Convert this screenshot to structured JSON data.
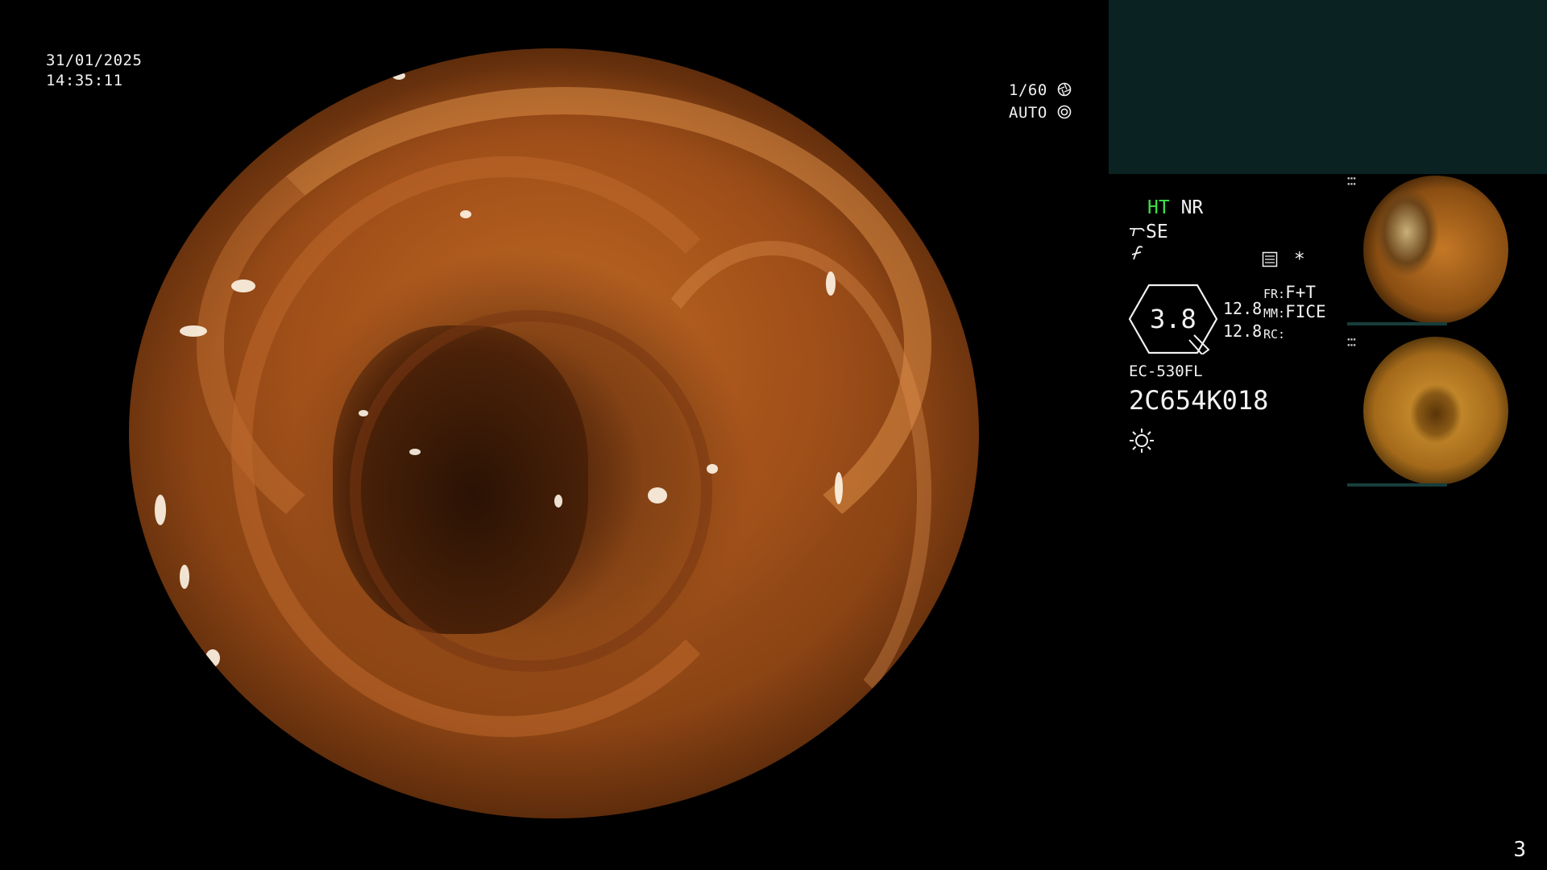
{
  "overlay": {
    "date": "31/01/2025",
    "time": "14:35:11",
    "shutter": "1/60",
    "exposure_mode": "AUTO"
  },
  "settings": {
    "ht": "HT",
    "nr": "NR",
    "se": "SE",
    "zoom": "3.8",
    "val1": "12.8",
    "val2": "12.8",
    "fr_label": "FR:",
    "fr_value": "F+T",
    "mm_label": "MM:",
    "mm_value": "FICE",
    "rc_label": "RC:",
    "asterisk": "*",
    "scope_model": "EC-530FL",
    "serial": "2C654K018"
  },
  "thumbnails": [
    {
      "label": "captured-image-1"
    },
    {
      "label": "captured-image-2"
    }
  ],
  "page_number": "3",
  "colors": {
    "accent_green": "#3ee04a",
    "panel_teal": "#0a2322",
    "tissue": "#b25e20"
  },
  "icons": [
    "shutter-icon",
    "iris-icon",
    "se-icon",
    "freeze-icon",
    "memory-icon",
    "brightness-icon",
    "zoom-badge-icon"
  ]
}
